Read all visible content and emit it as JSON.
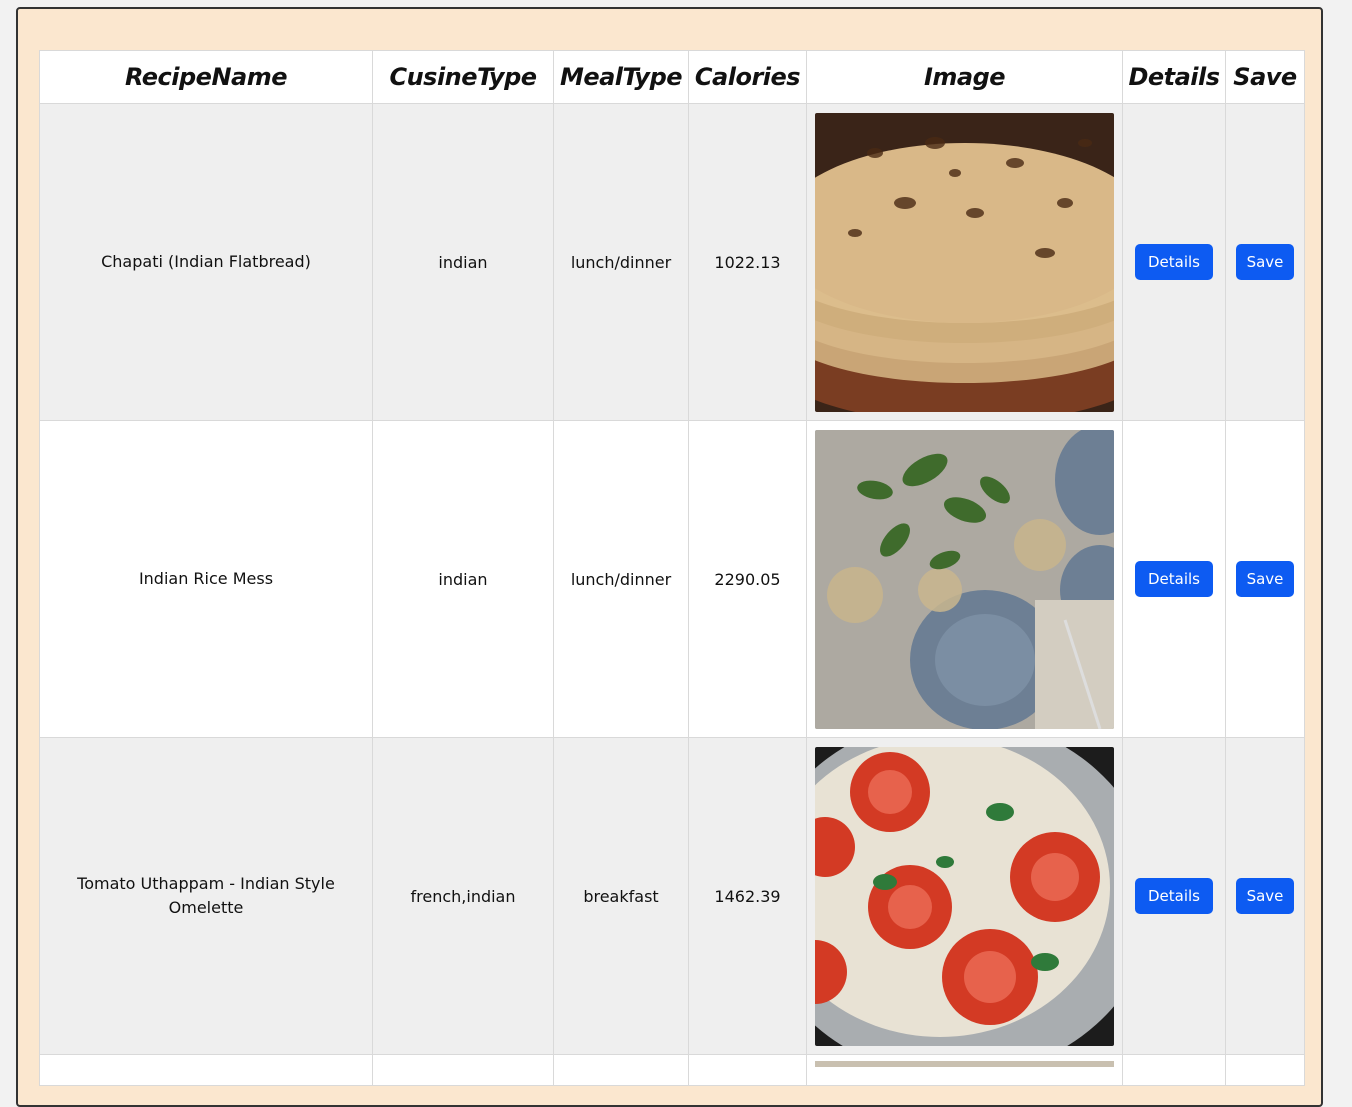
{
  "table": {
    "headers": [
      "RecipeName",
      "CusineType",
      "MealType",
      "Calories",
      "Image",
      "Details",
      "Save"
    ],
    "rows": [
      {
        "name": "Chapati (Indian Flatbread)",
        "cuisine": "indian",
        "meal": "lunch/dinner",
        "calories": "1022.13",
        "image": "chapati-flatbread-photo",
        "details": "Details",
        "save": "Save"
      },
      {
        "name": "Indian Rice Mess",
        "cuisine": "indian",
        "meal": "lunch/dinner",
        "calories": "2290.05",
        "image": "table-setting-photo",
        "details": "Details",
        "save": "Save"
      },
      {
        "name": "Tomato Uthappam - Indian Style Omelette",
        "cuisine": "french,indian",
        "meal": "breakfast",
        "calories": "1462.39",
        "image": "tomato-uthappam-photo",
        "details": "Details",
        "save": "Save"
      }
    ]
  }
}
